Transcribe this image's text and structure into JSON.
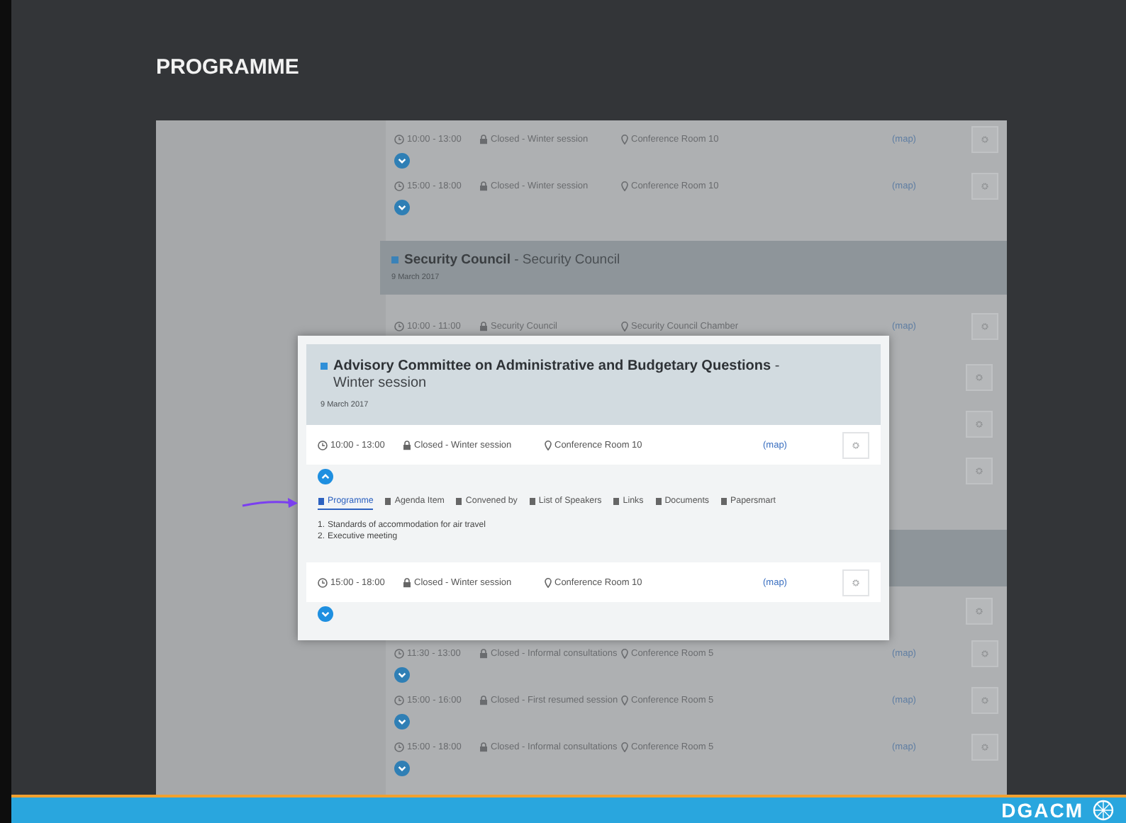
{
  "slide": {
    "title": "PROGRAMME",
    "footer_brand": "DGACM"
  },
  "background_page": {
    "items": [
      {
        "kind": "row",
        "time": "10:00 - 13:00",
        "access": "Closed - Winter session",
        "location": "Conference Room 10",
        "map": "(map)",
        "expanded": false
      },
      {
        "kind": "row",
        "time": "15:00 - 18:00",
        "access": "Closed - Winter session",
        "location": "Conference Room 10",
        "map": "(map)",
        "expanded": false
      },
      {
        "kind": "header",
        "title": "**Security Council** - Security Council",
        "date": "9 March 2017"
      },
      {
        "kind": "row",
        "time": "10:00 - 11:00",
        "access": "Security Council",
        "location": "Security Council Chamber",
        "map": "(map)"
      },
      {
        "kind": "covered_row"
      },
      {
        "kind": "covered_row"
      },
      {
        "kind": "covered_row"
      },
      {
        "kind": "covered_header"
      },
      {
        "kind": "covered_row"
      },
      {
        "kind": "row",
        "time": "11:30 - 13:00",
        "access": "Closed - Informal consultations",
        "location": "Conference Room 5",
        "map": "(map)",
        "expanded": false
      },
      {
        "kind": "row",
        "time": "15:00 - 16:00",
        "access": "Closed - First resumed session",
        "location": "Conference Room 5",
        "map": "(map)",
        "expanded": false
      },
      {
        "kind": "row",
        "time": "15:00 - 18:00",
        "access": "Closed - Informal consultations",
        "location": "Conference Room 5",
        "map": "(map)",
        "expanded": false
      }
    ]
  },
  "popup": {
    "title": "**Advisory Committee on Administrative and Budgetary Questions** - Winter session",
    "date": "9 March 2017",
    "rows": [
      {
        "time": "10:00 - 13:00",
        "access": "Closed - Winter session",
        "location": "Conference Room 10",
        "map": "(map)",
        "expanded": true,
        "tabs": [
          {
            "label": "Programme",
            "selected": true
          },
          {
            "label": "Agenda Item",
            "selected": false
          },
          {
            "label": "Convened by",
            "selected": false
          },
          {
            "label": "List of Speakers",
            "selected": false
          },
          {
            "label": "Links",
            "selected": false
          },
          {
            "label": "Documents",
            "selected": false
          },
          {
            "label": "Papersmart",
            "selected": false
          }
        ],
        "programme": [
          {
            "number": "1.",
            "text": "Standards of accommodation for air travel"
          },
          {
            "number": "2.",
            "text": "Executive meeting"
          }
        ]
      },
      {
        "time": "15:00 - 18:00",
        "access": "Closed - Winter session",
        "location": "Conference Room 10",
        "map": "(map)",
        "expanded": false
      }
    ]
  }
}
